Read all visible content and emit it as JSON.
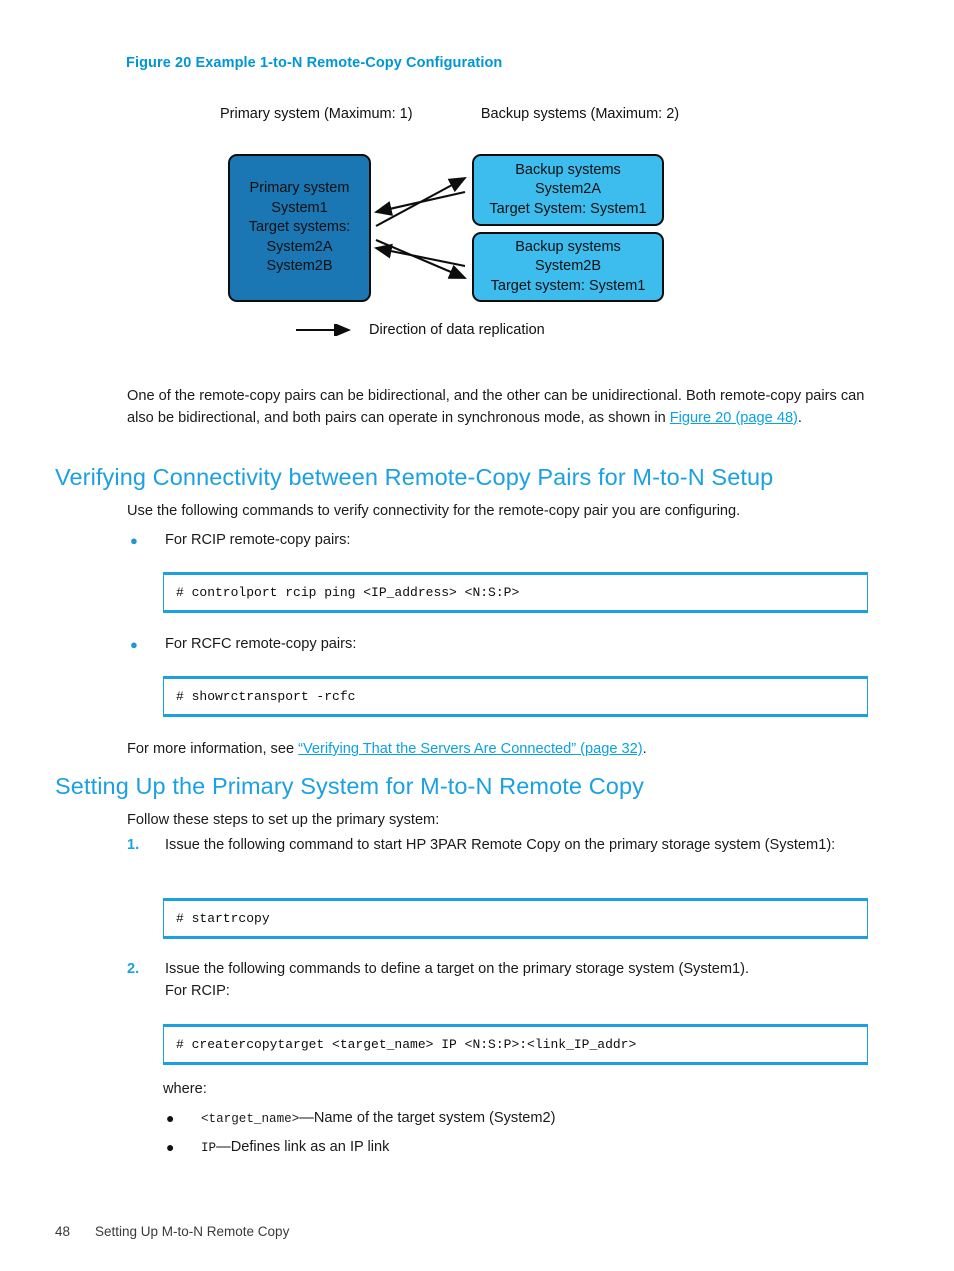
{
  "figure": {
    "caption": "Figure 20 Example 1-to-N Remote-Copy Configuration",
    "primary_header_line1": "Primary system",
    "primary_header_line2": "(Maximum: 1)",
    "backup_header_line1": "Backup systems",
    "backup_header_line2": "(Maximum: 2)",
    "primary_box": {
      "line1": "Primary system",
      "line2": "System1",
      "line3": "Target systems:",
      "line4": "System2A",
      "line5": "System2B",
      "fill": "#1b76b4"
    },
    "backup_box_a": {
      "line1": "Backup systems",
      "line2": "System2A",
      "line3": "Target System: System1",
      "fill": "#3cbdee"
    },
    "backup_box_b": {
      "line1": "Backup systems",
      "line2": "System2B",
      "line3": "Target system: System1",
      "fill": "#3cbdee"
    },
    "legend_label": "Direction of data replication"
  },
  "intro": {
    "text_part1": "One of the remote-copy pairs can be bidirectional, and the other can be unidirectional. Both remote-copy pairs can also be bidirectional, and both pairs can operate in synchronous mode, as shown in ",
    "link": "Figure 20 (page 48)",
    "text_part2": "."
  },
  "section1": {
    "heading": "Verifying Connectivity between Remote-Copy Pairs for M-to-N Setup",
    "lead": "Use the following commands to verify connectivity for the remote-copy pair you are configuring.",
    "bullet1": {
      "marker": "●",
      "label": "For RCIP remote-copy pairs:"
    },
    "code1": "# controlport rcip ping <IP_address> <N:S:P>",
    "bullet2": {
      "marker": "●",
      "label": "For RCFC remote-copy pairs:"
    },
    "code2": "# showrctransport -rcfc",
    "more_info_part1": "For more information, see ",
    "more_info_link": "“Verifying That the Servers Are Connected” (page 32)",
    "more_info_part2": "."
  },
  "section2": {
    "heading": "Setting Up the Primary System for M-to-N Remote Copy",
    "lead": "Follow these steps to set up the primary system:",
    "step1": {
      "marker": "1.",
      "text": "Issue the following command to start HP 3PAR Remote Copy on the primary storage system (System1):"
    },
    "code3": "# startrcopy",
    "step2": {
      "marker": "2.",
      "line1": "Issue the following commands to define a target on the primary storage system (System1).",
      "line2": "For RCIP:"
    },
    "code4": "# creatercopytarget <target_name> IP <N:S:P>:<link_IP_addr>",
    "where_label": "where:",
    "where_items": [
      {
        "marker": "●",
        "code": "<target_name>",
        "desc": "—Name of the target system (System2)"
      },
      {
        "marker": "●",
        "code": "IP",
        "desc": "—Defines link as an IP link"
      }
    ]
  },
  "footer": {
    "page_number": "48",
    "chapter_title": "Setting Up M-to-N Remote Copy"
  },
  "colors": {
    "accent_blue": "#0096d6",
    "heading_blue": "#1ba1e2",
    "link_blue": "#0aa3e0",
    "dark_box": "#1b76b4",
    "light_box": "#3cbdee"
  }
}
